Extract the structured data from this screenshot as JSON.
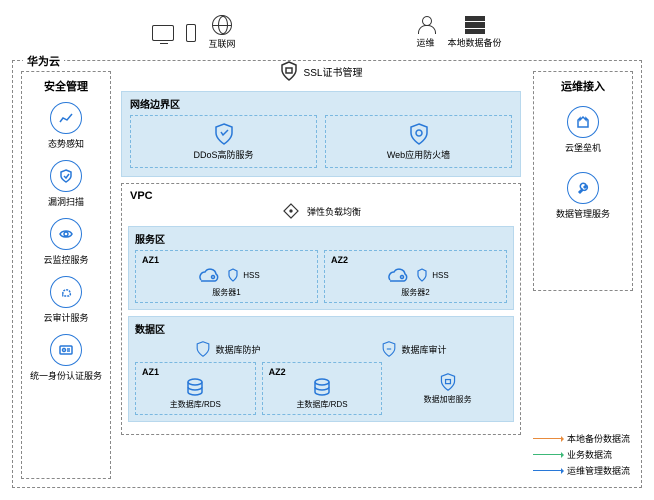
{
  "top": {
    "internet_label": "互联网",
    "ops_label": "运维",
    "backup_label": "本地数据备份"
  },
  "ssl_label": "SSL证书管理",
  "huawei_cloud_label": "华为云",
  "security_mgmt": {
    "title": "安全管理",
    "items": [
      "态势感知",
      "漏洞扫描",
      "云监控服务",
      "云审计服务",
      "统一身份认证服务"
    ]
  },
  "edge_zone": {
    "title": "网络边界区",
    "ddos": "DDoS高防服务",
    "waf": "Web应用防火墙"
  },
  "vpc": {
    "title": "VPC",
    "elb": "弹性负载均衡",
    "service_zone": {
      "title": "服务区",
      "az1": "AZ1",
      "az2": "AZ2",
      "server1": "服务器1",
      "server2": "服务器2",
      "hss": "HSS"
    },
    "data_zone": {
      "title": "数据区",
      "db_protect": "数据库防护",
      "db_audit": "数据库审计",
      "az1": "AZ1",
      "az2": "AZ2",
      "rds1": "主数据库/RDS",
      "rds2": "主数据库/RDS",
      "encrypt": "数据加密服务"
    }
  },
  "ops_access": {
    "title": "运维接入",
    "bastion": "云堡垒机",
    "data_mgmt": "数据管理服务"
  },
  "legend": {
    "backup": "本地备份数据流",
    "business": "业务数据流",
    "ops": "运维管理数据流"
  }
}
